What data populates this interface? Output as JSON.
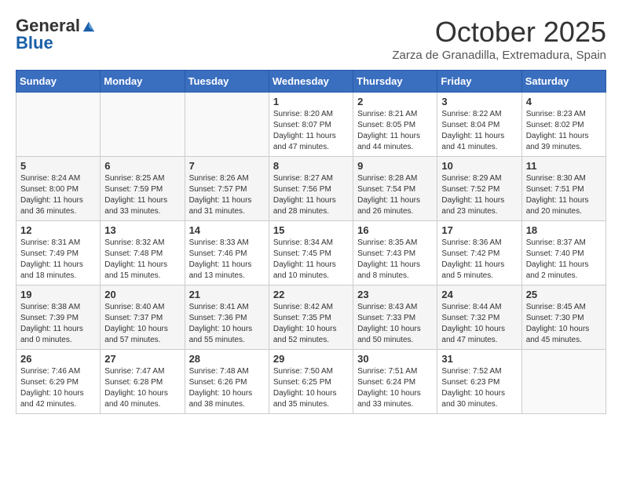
{
  "header": {
    "logo_general": "General",
    "logo_blue": "Blue",
    "month_title": "October 2025",
    "subtitle": "Zarza de Granadilla, Extremadura, Spain"
  },
  "days_of_week": [
    "Sunday",
    "Monday",
    "Tuesday",
    "Wednesday",
    "Thursday",
    "Friday",
    "Saturday"
  ],
  "weeks": [
    [
      {
        "day": "",
        "info": ""
      },
      {
        "day": "",
        "info": ""
      },
      {
        "day": "",
        "info": ""
      },
      {
        "day": "1",
        "info": "Sunrise: 8:20 AM\nSunset: 8:07 PM\nDaylight: 11 hours and 47 minutes."
      },
      {
        "day": "2",
        "info": "Sunrise: 8:21 AM\nSunset: 8:05 PM\nDaylight: 11 hours and 44 minutes."
      },
      {
        "day": "3",
        "info": "Sunrise: 8:22 AM\nSunset: 8:04 PM\nDaylight: 11 hours and 41 minutes."
      },
      {
        "day": "4",
        "info": "Sunrise: 8:23 AM\nSunset: 8:02 PM\nDaylight: 11 hours and 39 minutes."
      }
    ],
    [
      {
        "day": "5",
        "info": "Sunrise: 8:24 AM\nSunset: 8:00 PM\nDaylight: 11 hours and 36 minutes."
      },
      {
        "day": "6",
        "info": "Sunrise: 8:25 AM\nSunset: 7:59 PM\nDaylight: 11 hours and 33 minutes."
      },
      {
        "day": "7",
        "info": "Sunrise: 8:26 AM\nSunset: 7:57 PM\nDaylight: 11 hours and 31 minutes."
      },
      {
        "day": "8",
        "info": "Sunrise: 8:27 AM\nSunset: 7:56 PM\nDaylight: 11 hours and 28 minutes."
      },
      {
        "day": "9",
        "info": "Sunrise: 8:28 AM\nSunset: 7:54 PM\nDaylight: 11 hours and 26 minutes."
      },
      {
        "day": "10",
        "info": "Sunrise: 8:29 AM\nSunset: 7:52 PM\nDaylight: 11 hours and 23 minutes."
      },
      {
        "day": "11",
        "info": "Sunrise: 8:30 AM\nSunset: 7:51 PM\nDaylight: 11 hours and 20 minutes."
      }
    ],
    [
      {
        "day": "12",
        "info": "Sunrise: 8:31 AM\nSunset: 7:49 PM\nDaylight: 11 hours and 18 minutes."
      },
      {
        "day": "13",
        "info": "Sunrise: 8:32 AM\nSunset: 7:48 PM\nDaylight: 11 hours and 15 minutes."
      },
      {
        "day": "14",
        "info": "Sunrise: 8:33 AM\nSunset: 7:46 PM\nDaylight: 11 hours and 13 minutes."
      },
      {
        "day": "15",
        "info": "Sunrise: 8:34 AM\nSunset: 7:45 PM\nDaylight: 11 hours and 10 minutes."
      },
      {
        "day": "16",
        "info": "Sunrise: 8:35 AM\nSunset: 7:43 PM\nDaylight: 11 hours and 8 minutes."
      },
      {
        "day": "17",
        "info": "Sunrise: 8:36 AM\nSunset: 7:42 PM\nDaylight: 11 hours and 5 minutes."
      },
      {
        "day": "18",
        "info": "Sunrise: 8:37 AM\nSunset: 7:40 PM\nDaylight: 11 hours and 2 minutes."
      }
    ],
    [
      {
        "day": "19",
        "info": "Sunrise: 8:38 AM\nSunset: 7:39 PM\nDaylight: 11 hours and 0 minutes."
      },
      {
        "day": "20",
        "info": "Sunrise: 8:40 AM\nSunset: 7:37 PM\nDaylight: 10 hours and 57 minutes."
      },
      {
        "day": "21",
        "info": "Sunrise: 8:41 AM\nSunset: 7:36 PM\nDaylight: 10 hours and 55 minutes."
      },
      {
        "day": "22",
        "info": "Sunrise: 8:42 AM\nSunset: 7:35 PM\nDaylight: 10 hours and 52 minutes."
      },
      {
        "day": "23",
        "info": "Sunrise: 8:43 AM\nSunset: 7:33 PM\nDaylight: 10 hours and 50 minutes."
      },
      {
        "day": "24",
        "info": "Sunrise: 8:44 AM\nSunset: 7:32 PM\nDaylight: 10 hours and 47 minutes."
      },
      {
        "day": "25",
        "info": "Sunrise: 8:45 AM\nSunset: 7:30 PM\nDaylight: 10 hours and 45 minutes."
      }
    ],
    [
      {
        "day": "26",
        "info": "Sunrise: 7:46 AM\nSunset: 6:29 PM\nDaylight: 10 hours and 42 minutes."
      },
      {
        "day": "27",
        "info": "Sunrise: 7:47 AM\nSunset: 6:28 PM\nDaylight: 10 hours and 40 minutes."
      },
      {
        "day": "28",
        "info": "Sunrise: 7:48 AM\nSunset: 6:26 PM\nDaylight: 10 hours and 38 minutes."
      },
      {
        "day": "29",
        "info": "Sunrise: 7:50 AM\nSunset: 6:25 PM\nDaylight: 10 hours and 35 minutes."
      },
      {
        "day": "30",
        "info": "Sunrise: 7:51 AM\nSunset: 6:24 PM\nDaylight: 10 hours and 33 minutes."
      },
      {
        "day": "31",
        "info": "Sunrise: 7:52 AM\nSunset: 6:23 PM\nDaylight: 10 hours and 30 minutes."
      },
      {
        "day": "",
        "info": ""
      }
    ]
  ]
}
